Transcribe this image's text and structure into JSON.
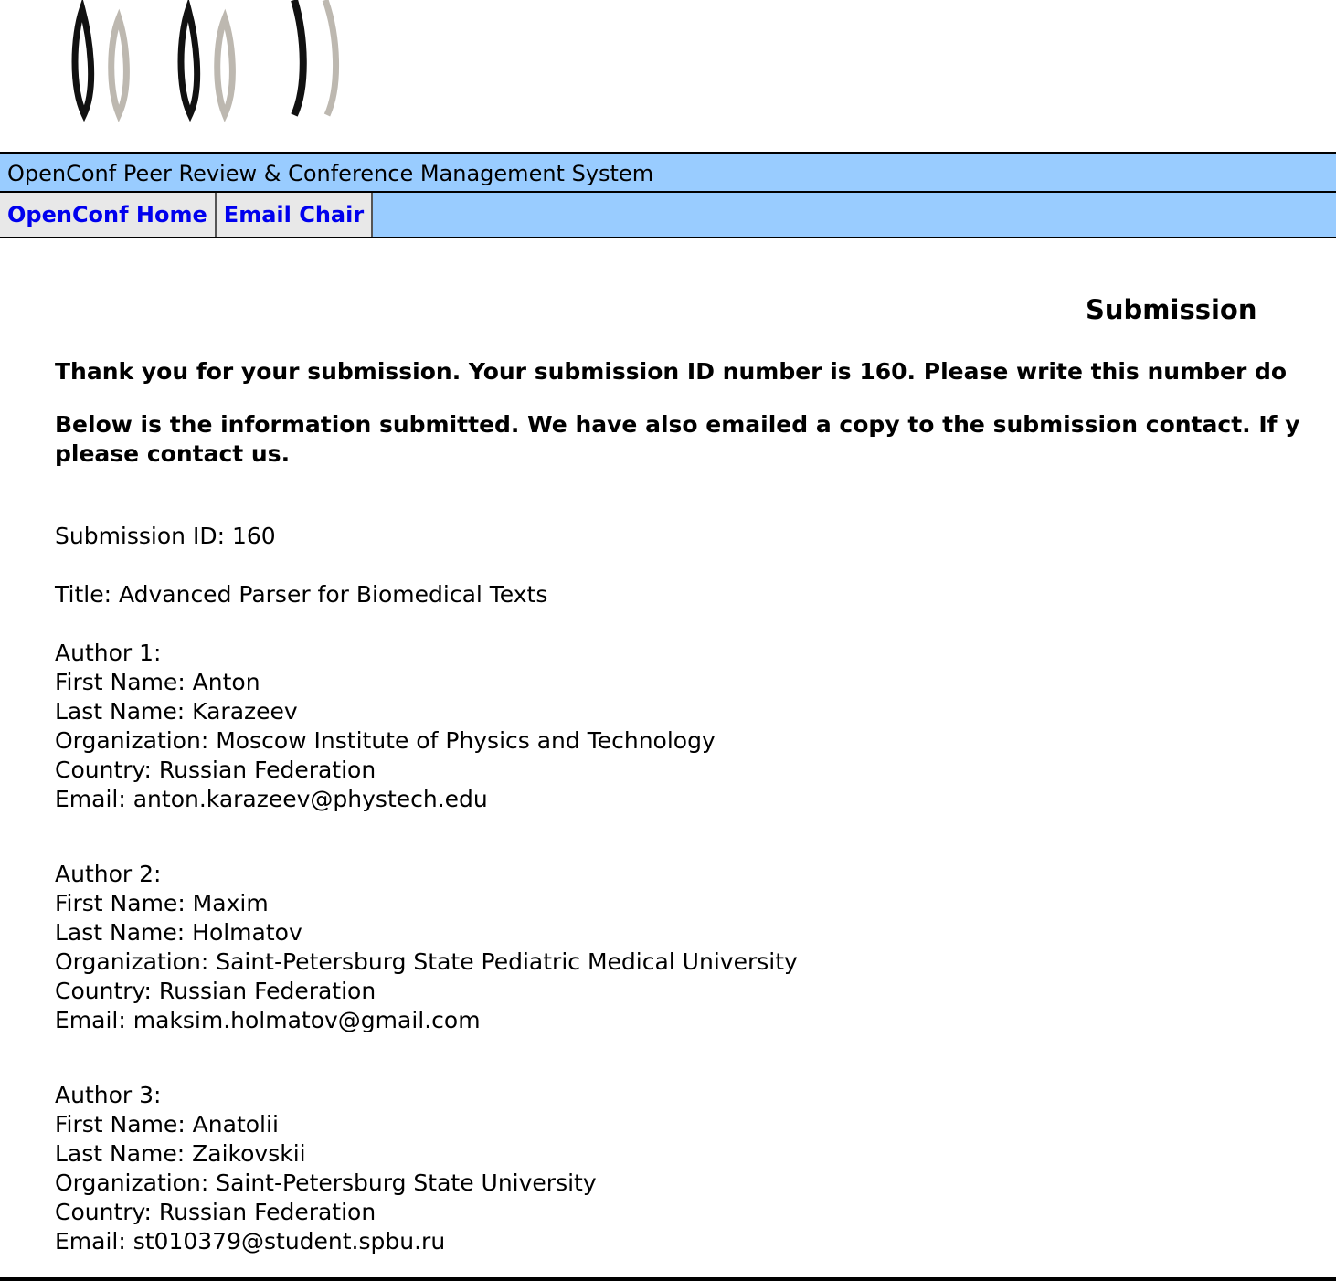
{
  "header": {
    "system_title": "OpenConf Peer Review & Conference Management System",
    "nav": [
      {
        "label": "OpenConf Home"
      },
      {
        "label": "Email Chair"
      }
    ]
  },
  "main": {
    "heading": "Submission",
    "thank_you": "Thank you for your submission. Your submission ID number is 160. Please write this number do",
    "info_line1": "Below is the information submitted. We have also emailed a copy to the submission contact. If y",
    "info_line2": "please contact us.",
    "submission_id": "Submission ID: 160",
    "title": "Title: Advanced Parser for Biomedical Texts",
    "authors": [
      {
        "header": "Author 1:",
        "first_name": "First Name: Anton",
        "last_name": "Last Name: Karazeev",
        "organization": "Organization: Moscow Institute of Physics and Technology",
        "country": "Country: Russian Federation",
        "email": "Email: anton.karazeev@phystech.edu"
      },
      {
        "header": "Author 2:",
        "first_name": "First Name: Maxim",
        "last_name": "Last Name: Holmatov",
        "organization": "Organization: Saint-Petersburg State Pediatric Medical University",
        "country": "Country: Russian Federation",
        "email": "Email: maksim.holmatov@gmail.com"
      },
      {
        "header": "Author 3:",
        "first_name": "First Name: Anatolii",
        "last_name": "Last Name: Zaikovskii",
        "organization": "Organization: Saint-Petersburg State University",
        "country": "Country: Russian Federation",
        "email": "Email: st010379@student.spbu.ru"
      }
    ]
  },
  "colors": {
    "header_bg": "#99ccff",
    "link": "#0000ee",
    "nav_cell_bg": "#e8e8e8",
    "logo_dark": "#111111",
    "logo_light": "#bdb8b0"
  }
}
